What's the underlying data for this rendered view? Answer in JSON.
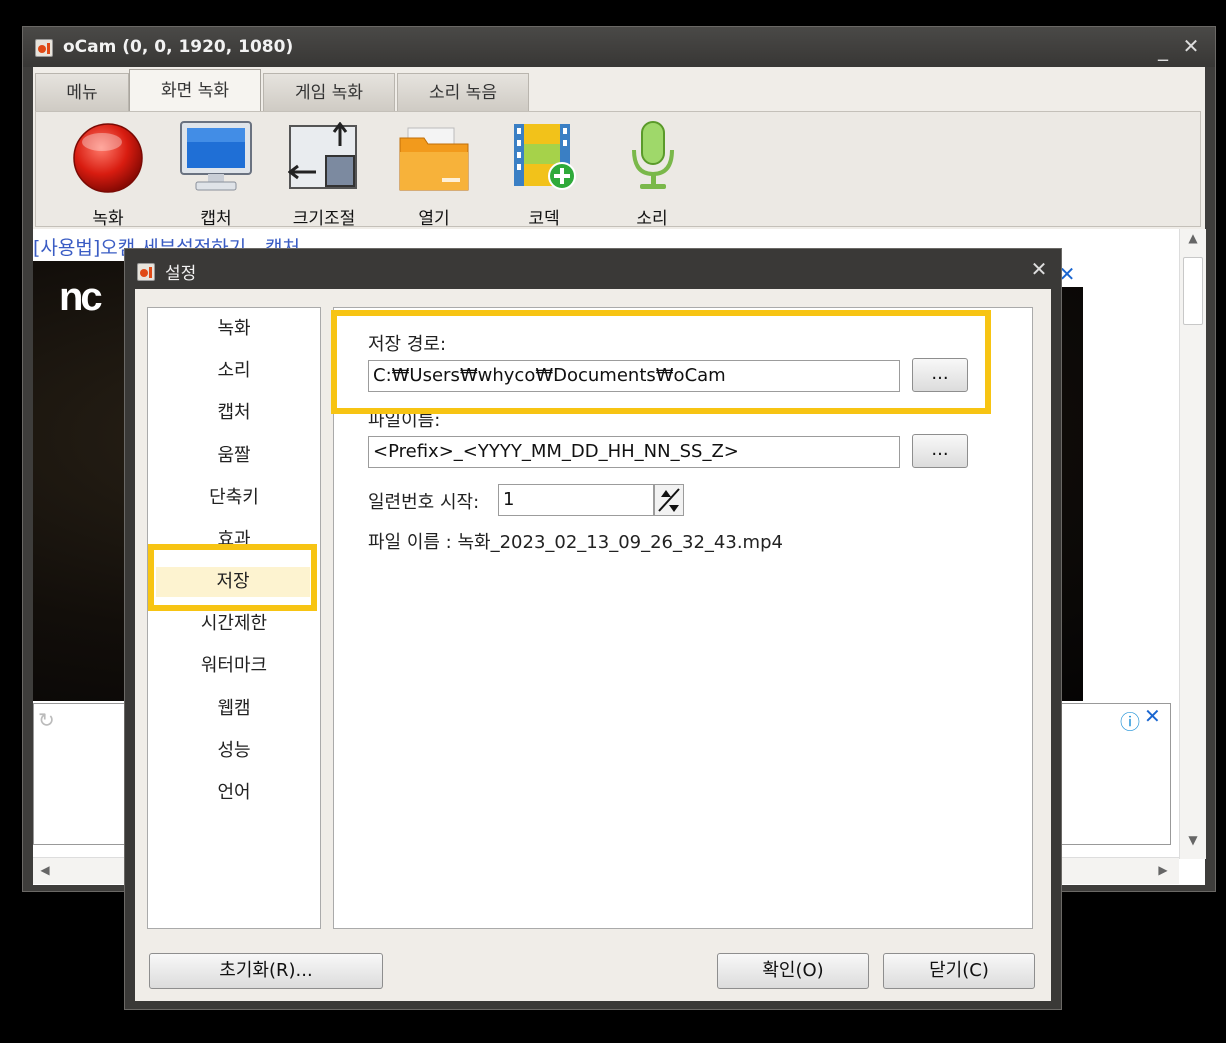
{
  "main_window": {
    "title": "oCam (0, 0, 1920, 1080)",
    "minimize": "_",
    "close": "✕",
    "tabs": [
      {
        "label": "메뉴"
      },
      {
        "label": "화면 녹화"
      },
      {
        "label": "게임 녹화"
      },
      {
        "label": "소리 녹음"
      }
    ],
    "toolbar": [
      {
        "label": "녹화",
        "icon": "record-icon"
      },
      {
        "label": "캡처",
        "icon": "monitor-icon"
      },
      {
        "label": "크기조절",
        "icon": "resize-icon"
      },
      {
        "label": "열기",
        "icon": "folder-icon"
      },
      {
        "label": "코덱",
        "icon": "codec-film-icon"
      },
      {
        "label": "소리",
        "icon": "microphone-icon"
      }
    ],
    "help_link": "[사용법]오캠 세부설정하기 - 캡처",
    "banner_logo": "nc",
    "ad_close": "✕",
    "ad_info": "ⓘ"
  },
  "dialog": {
    "title": "설정",
    "close": "✕",
    "nav_items": [
      "녹화",
      "소리",
      "캡처",
      "움짤",
      "단축키",
      "효과",
      "저장",
      "시간제한",
      "워터마크",
      "웹캠",
      "성능",
      "언어"
    ],
    "selected_nav": "저장",
    "save_path_label": "저장 경로:",
    "save_path_value": "C:₩Users₩whyco₩Documents₩oCam",
    "browse_label": "...",
    "file_name_label": "파일이름:",
    "file_name_value": "<Prefix>_<YYYY_MM_DD_HH_NN_SS_Z>",
    "serial_label": "일련번호 시작:",
    "serial_value": "1",
    "file_preview": "파일 이름 : 녹화_2023_02_13_09_26_32_43.mp4",
    "reset_button": "초기화(R)...",
    "ok_button": "확인(O)",
    "close_button": "닫기(C)"
  },
  "colors": {
    "highlight": "#f7c413",
    "link": "#3a5cc4",
    "selected_nav_bg": "#fdf3d0"
  }
}
